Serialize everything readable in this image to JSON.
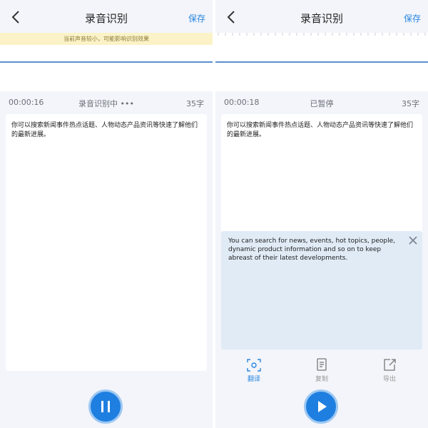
{
  "left_screen": {
    "header": {
      "title": "录音识别",
      "save_label": "保存"
    },
    "notice": "当前声音较小，可能影响识别效果",
    "status_bar": {
      "time": "00:00:16",
      "status": "录音识别中 •••",
      "count": "35字"
    },
    "transcript": "你可以搜索新闻事件热点话题、人物动态产品资讯等快速了解他们的最新进展。",
    "control": {
      "icon": "pause-icon",
      "state": "recording"
    }
  },
  "right_screen": {
    "header": {
      "title": "录音识别",
      "save_label": "保存"
    },
    "status_bar": {
      "time": "00:00:18",
      "status": "已暂停",
      "count": "35字"
    },
    "transcript": "你可以搜索新闻事件热点话题、人物动态产品资讯等快速了解他们的最新进展。",
    "translation": "You can search for news, events, hot topics, people, dynamic product information and so on to keep abreast of their latest developments.",
    "toolbar": [
      {
        "label": "翻译",
        "icon": "translate-icon",
        "active": true
      },
      {
        "label": "复制",
        "icon": "copy-icon",
        "active": false
      },
      {
        "label": "导出",
        "icon": "export-icon",
        "active": false
      }
    ],
    "control": {
      "icon": "play-icon",
      "state": "paused"
    }
  },
  "colors": {
    "accent": "#1f7fe0",
    "link": "#2a86e0",
    "notice_bg": "#fbf3c7",
    "translate_bg": "#e0ebf6",
    "page_bg": "#f3f5fa"
  }
}
